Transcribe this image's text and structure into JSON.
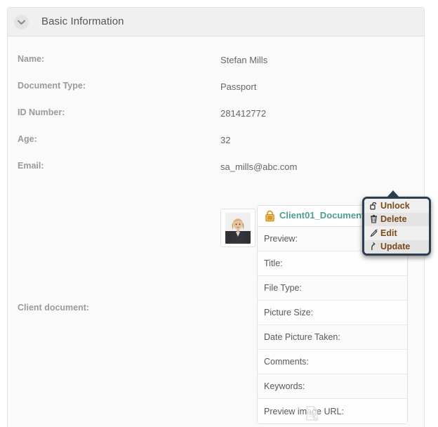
{
  "panel": {
    "title": "Basic Information",
    "collapse_icon": "chevron-down-icon"
  },
  "fields": [
    {
      "label": "Name:",
      "value": "Stefan Mills"
    },
    {
      "label": "Document Type:",
      "value": "Passport"
    },
    {
      "label": "ID Number:",
      "value": "281412772"
    },
    {
      "label": "Age:",
      "value": "32"
    },
    {
      "label": "Email:",
      "value": "sa_mills@abc.com"
    }
  ],
  "document_section": {
    "label": "Client document:",
    "thumbnail_alt": "client-portrait-photo",
    "lock_icon": "lock-closed-icon",
    "file_name": "Client01_Document.png",
    "gear_icon": "gear-icon",
    "detail_rows": [
      "Preview:",
      "Title:",
      "File Type:",
      "Picture Size:",
      "Date Picture Taken:",
      "Comments:",
      "Keywords:",
      "Preview image URL:"
    ],
    "bottom_icon": "document-page-icon"
  },
  "context_menu": {
    "items": [
      {
        "label": "Unlock",
        "icon": "unlock-icon"
      },
      {
        "label": "Delete",
        "icon": "trash-icon"
      },
      {
        "label": "Edit",
        "icon": "pencil-icon"
      },
      {
        "label": "Update",
        "icon": "refresh-arrow-icon"
      }
    ]
  },
  "colors": {
    "file_name": "#4d9e8e",
    "menu_border": "#2c3e50",
    "menu_text": "#7a4a1a",
    "lock": "#e8a33d",
    "label": "#9a9a9a",
    "value": "#666666"
  }
}
